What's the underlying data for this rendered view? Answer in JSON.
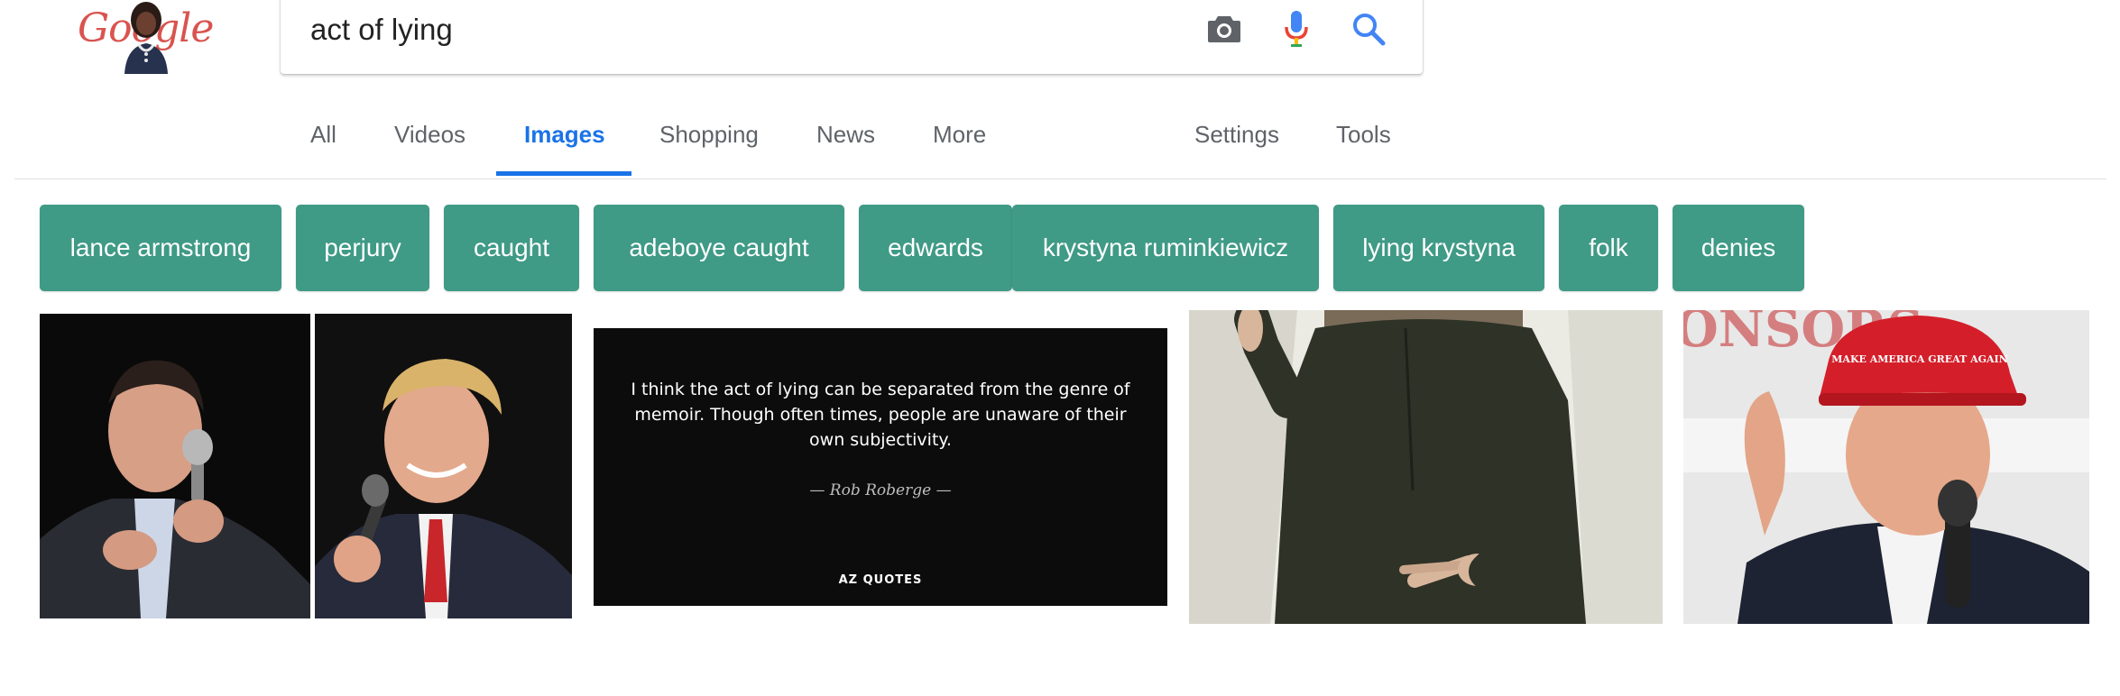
{
  "logo": {
    "text": "Google"
  },
  "search": {
    "query": "act of lying"
  },
  "tabs": [
    {
      "label": "All"
    },
    {
      "label": "Videos"
    },
    {
      "label": "Images"
    },
    {
      "label": "Shopping"
    },
    {
      "label": "News"
    },
    {
      "label": "More"
    },
    {
      "label": "Settings"
    },
    {
      "label": "Tools"
    }
  ],
  "active_tab": "Images",
  "chips": [
    "lance armstrong",
    "perjury",
    "caught",
    "adeboye caught",
    "edwards",
    "krystyna ruminkiewicz",
    "lying krystyna",
    "folk",
    "denies"
  ],
  "results": {
    "quote": {
      "text": "I think the act of lying can be separated from the genre of memoir. Though often times, people are unaware of their own subjectivity.",
      "author": "— Rob Roberge —",
      "brand": "AZ QUOTES"
    },
    "cap_text": "MAKE AMERICA GREAT AGAIN",
    "banner_text": "ONSORS"
  },
  "colors": {
    "accent": "#1a73e8",
    "chip_bg": "#3f9a86",
    "tab_text": "#5f6368"
  }
}
